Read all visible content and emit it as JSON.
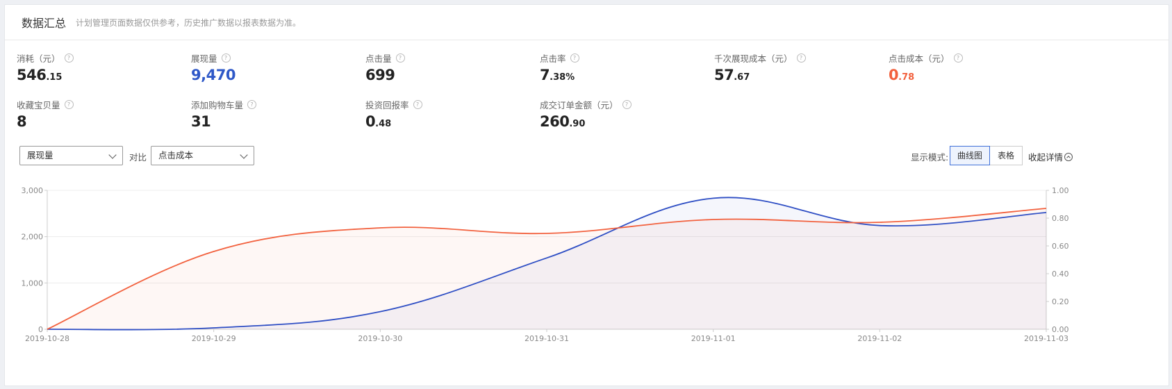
{
  "header": {
    "title": "数据汇总",
    "subtitle": "计划管理页面数据仅供参考，历史推广数据以报表数据为准。"
  },
  "metrics": [
    {
      "label": "消耗（元）",
      "int": "546",
      "dec": ".15",
      "color": "normal"
    },
    {
      "label": "展现量",
      "int": "9,470",
      "dec": "",
      "color": "blue"
    },
    {
      "label": "点击量",
      "int": "699",
      "dec": "",
      "color": "normal"
    },
    {
      "label": "点击率",
      "int": "7",
      "dec": ".38%",
      "color": "normal"
    },
    {
      "label": "千次展现成本（元）",
      "int": "57",
      "dec": ".67",
      "color": "normal"
    },
    {
      "label": "点击成本（元）",
      "int": "0",
      "dec": ".78",
      "color": "red"
    },
    {
      "label": "收藏宝贝量",
      "int": "8",
      "dec": "",
      "color": "normal"
    },
    {
      "label": "添加购物车量",
      "int": "31",
      "dec": "",
      "color": "normal"
    },
    {
      "label": "投资回报率",
      "int": "0",
      "dec": ".48",
      "color": "normal"
    },
    {
      "label": "成交订单金额（元）",
      "int": "260",
      "dec": ".90",
      "color": "normal"
    }
  ],
  "help_glyph": "?",
  "controls": {
    "primary_select": "展现量",
    "compare_label": "对比",
    "compare_select": "点击成本",
    "mode_label": "显示模式:",
    "mode_curve": "曲线图",
    "mode_table": "表格",
    "collapse_label": "收起详情"
  },
  "chart_data": {
    "type": "area",
    "x": [
      "2019-10-28",
      "2019-10-29",
      "2019-10-30",
      "2019-10-31",
      "2019-11-01",
      "2019-11-02",
      "2019-11-03"
    ],
    "series": [
      {
        "axis": "left",
        "color": "#2e4ec4",
        "values": [
          0,
          30,
          380,
          1540,
          2830,
          2240,
          2520
        ]
      },
      {
        "axis": "right",
        "color": "#f2613e",
        "values": [
          0,
          0.56,
          0.73,
          0.69,
          0.79,
          0.77,
          0.87
        ]
      }
    ],
    "y_left": {
      "ticks": [
        "0",
        "1,000",
        "2,000",
        "3,000"
      ],
      "ylim": [
        0,
        3000
      ]
    },
    "y_right": {
      "ticks": [
        "0.00",
        "0.20",
        "0.40",
        "0.60",
        "0.80",
        "1.00"
      ],
      "ylim": [
        0,
        1
      ]
    },
    "grid": true
  }
}
